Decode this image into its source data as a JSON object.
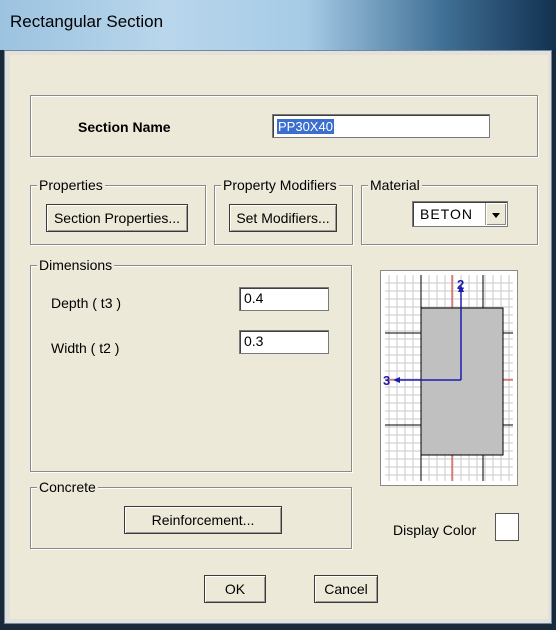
{
  "window": {
    "title": "Rectangular Section"
  },
  "section_name": {
    "label": "Section Name",
    "value": "PP30X40"
  },
  "properties": {
    "group_label": "Properties",
    "button_label": "Section Properties..."
  },
  "property_modifiers": {
    "group_label": "Property Modifiers",
    "button_label": "Set Modifiers..."
  },
  "material": {
    "group_label": "Material",
    "selected": "BETON"
  },
  "dimensions": {
    "group_label": "Dimensions",
    "depth_label": "Depth  ( t3 )",
    "depth_value": "0.4",
    "width_label": "Width  ( t2 )",
    "width_value": "0.3"
  },
  "preview": {
    "axis_vertical_label": "2",
    "axis_horizontal_label": "3"
  },
  "concrete": {
    "group_label": "Concrete",
    "button_label": "Reinforcement..."
  },
  "display_color": {
    "label": "Display Color",
    "color": "#ffffff"
  },
  "buttons": {
    "ok": "OK",
    "cancel": "Cancel"
  },
  "colors": {
    "accent": "#3a6fcf",
    "section_fill": "#c0c0c0",
    "axis": "#1c1cb0",
    "grid": "#c8c8c8",
    "red_line": "#e03030"
  }
}
